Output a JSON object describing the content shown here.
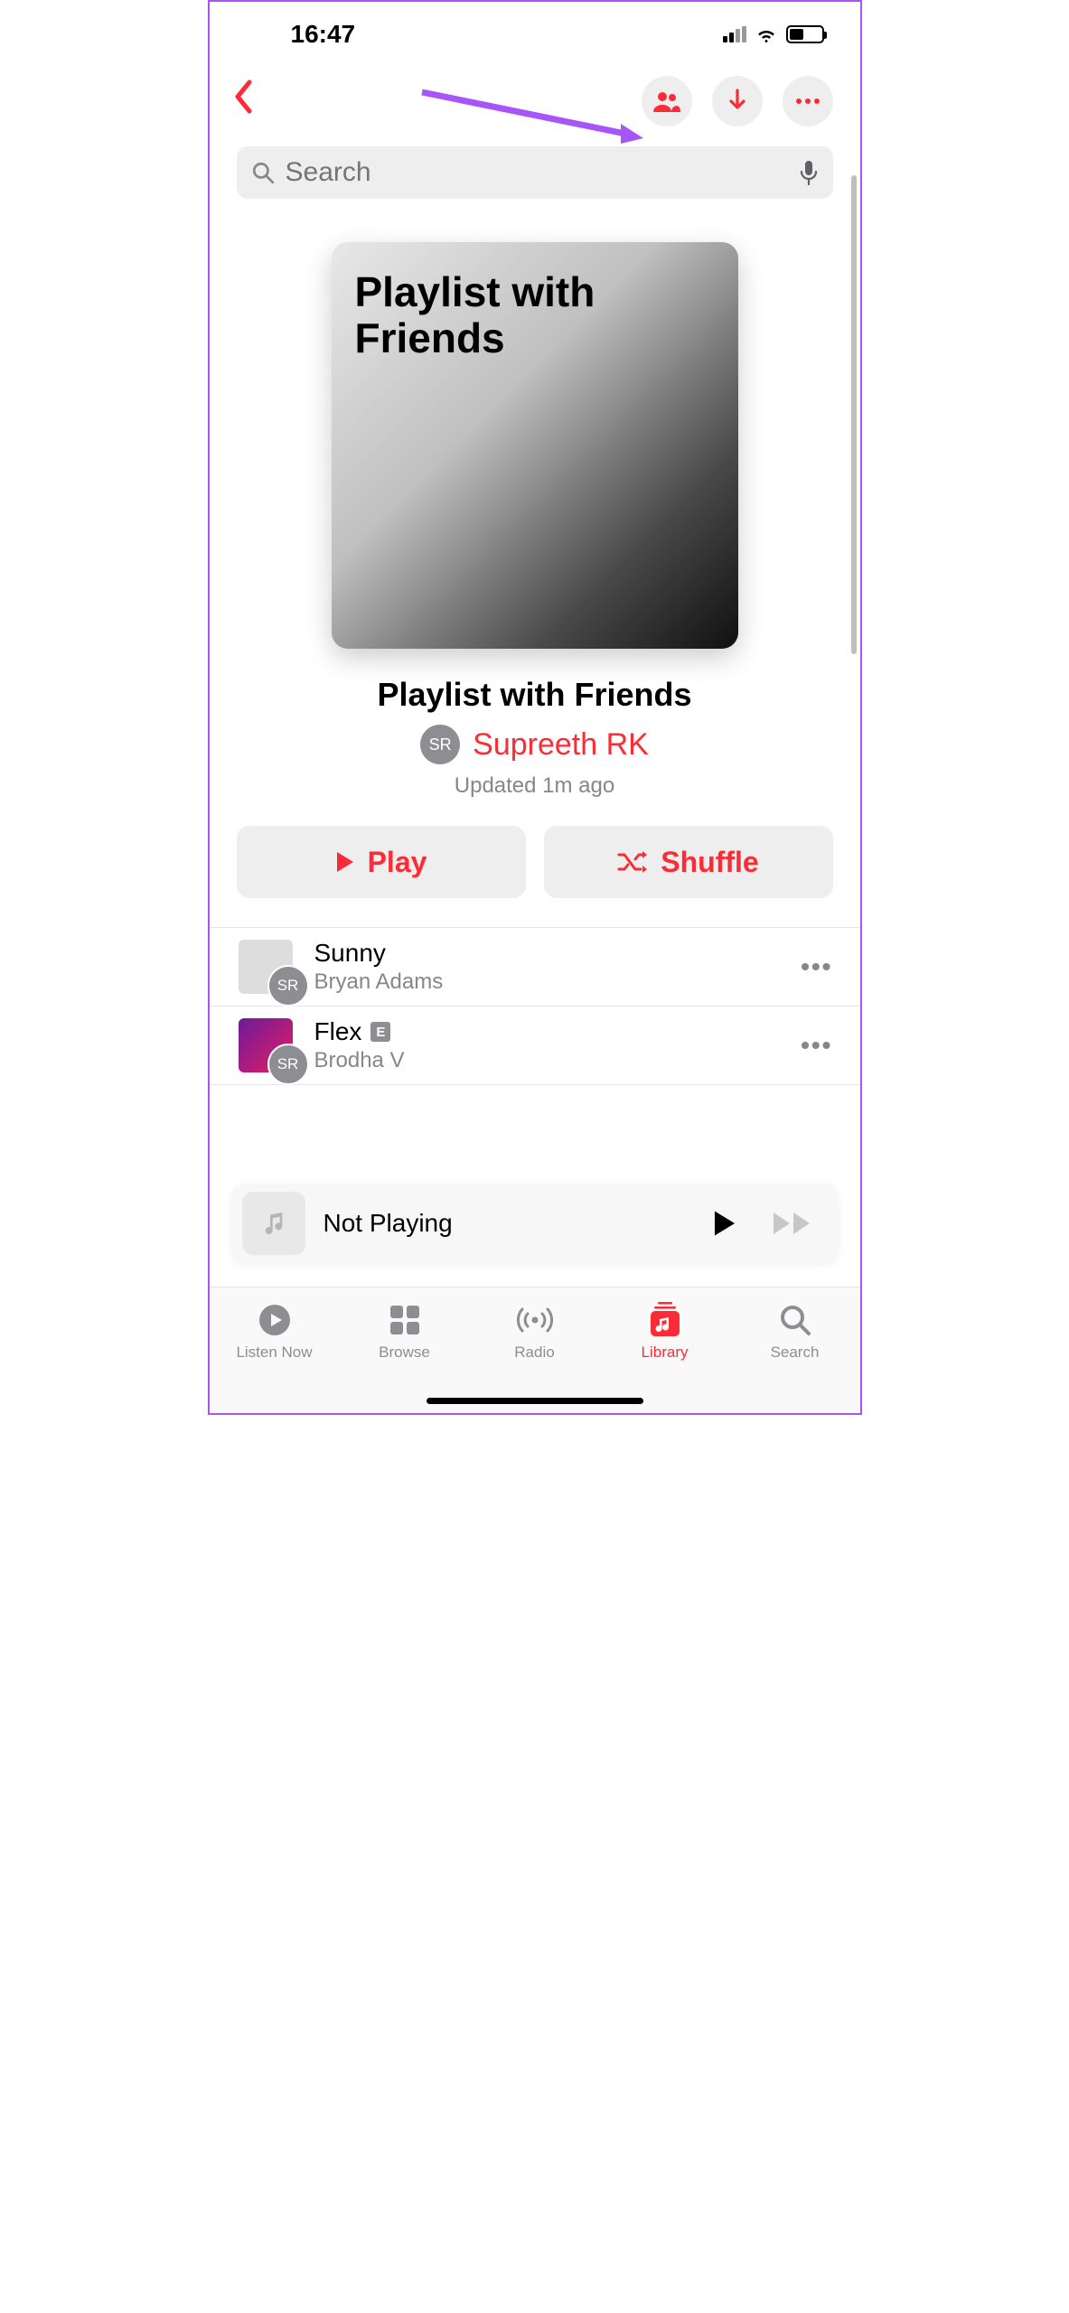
{
  "status": {
    "time": "16:47"
  },
  "search": {
    "placeholder": "Search"
  },
  "playlist": {
    "cover_title": "Playlist with Friends",
    "title": "Playlist with Friends",
    "owner_initials": "SR",
    "owner_name": "Supreeth RK",
    "updated": "Updated 1m ago"
  },
  "actions": {
    "play": "Play",
    "shuffle": "Shuffle"
  },
  "tracks": [
    {
      "title": "Sunny",
      "artist": "Bryan Adams",
      "explicit": false,
      "collab_initials": "SR"
    },
    {
      "title": "Flex",
      "artist": "Brodha V",
      "explicit": true,
      "collab_initials": "SR"
    }
  ],
  "explicit_label": "E",
  "now_playing": {
    "label": "Not Playing"
  },
  "tabs": {
    "listen_now": "Listen Now",
    "browse": "Browse",
    "radio": "Radio",
    "library": "Library",
    "search": "Search"
  },
  "colors": {
    "accent": "#fb2c36",
    "annotation": "#a855f7"
  }
}
